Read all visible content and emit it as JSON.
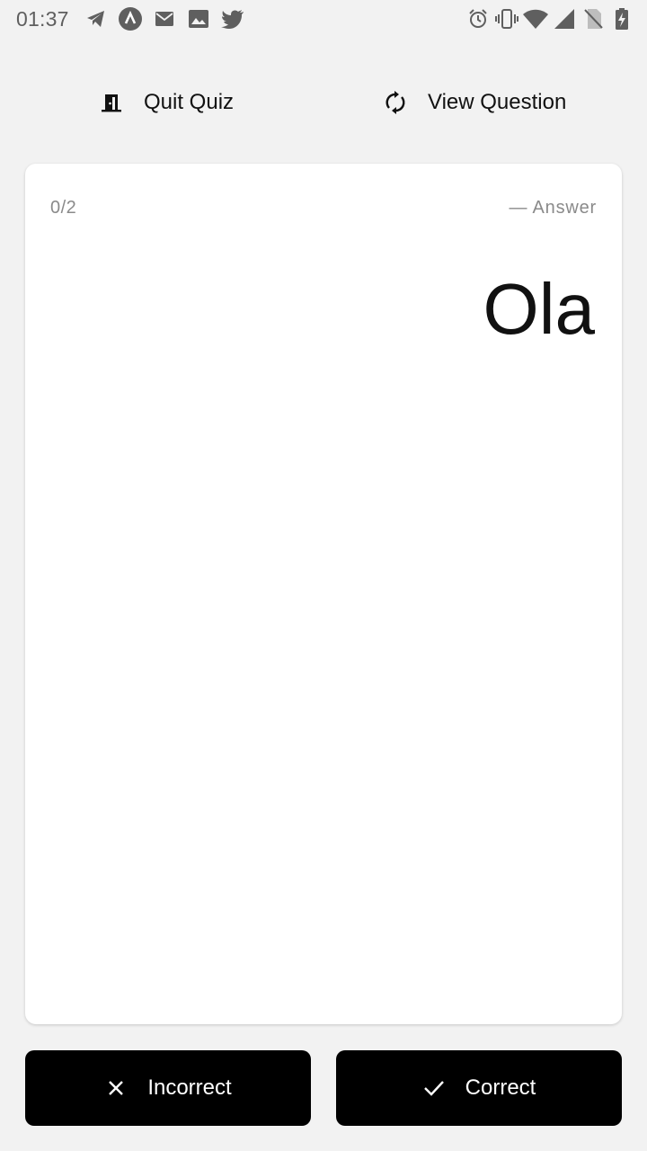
{
  "status_bar": {
    "time": "01:37",
    "left_icons": [
      "telegram-icon",
      "app-arrow-icon",
      "mail-icon",
      "image-icon",
      "twitter-icon"
    ],
    "right_icons": [
      "alarm-icon",
      "vibrate-icon",
      "wifi-icon",
      "signal-icon",
      "no-sim-icon",
      "battery-charging-icon"
    ]
  },
  "toolbar": {
    "quit_label": "Quit Quiz",
    "quit_icon": "door-exit-icon",
    "view_label": "View Question",
    "view_icon": "flip-sync-icon"
  },
  "card": {
    "progress": "0/2",
    "side_label": "— Answer",
    "answer_text": "Ola"
  },
  "actions": {
    "incorrect_label": "Incorrect",
    "incorrect_icon": "close-icon",
    "correct_label": "Correct",
    "correct_icon": "check-icon"
  },
  "colors": {
    "background": "#f2f2f2",
    "card": "#ffffff",
    "button": "#000000",
    "button_text": "#ffffff",
    "muted_text": "#8a8a8a"
  }
}
